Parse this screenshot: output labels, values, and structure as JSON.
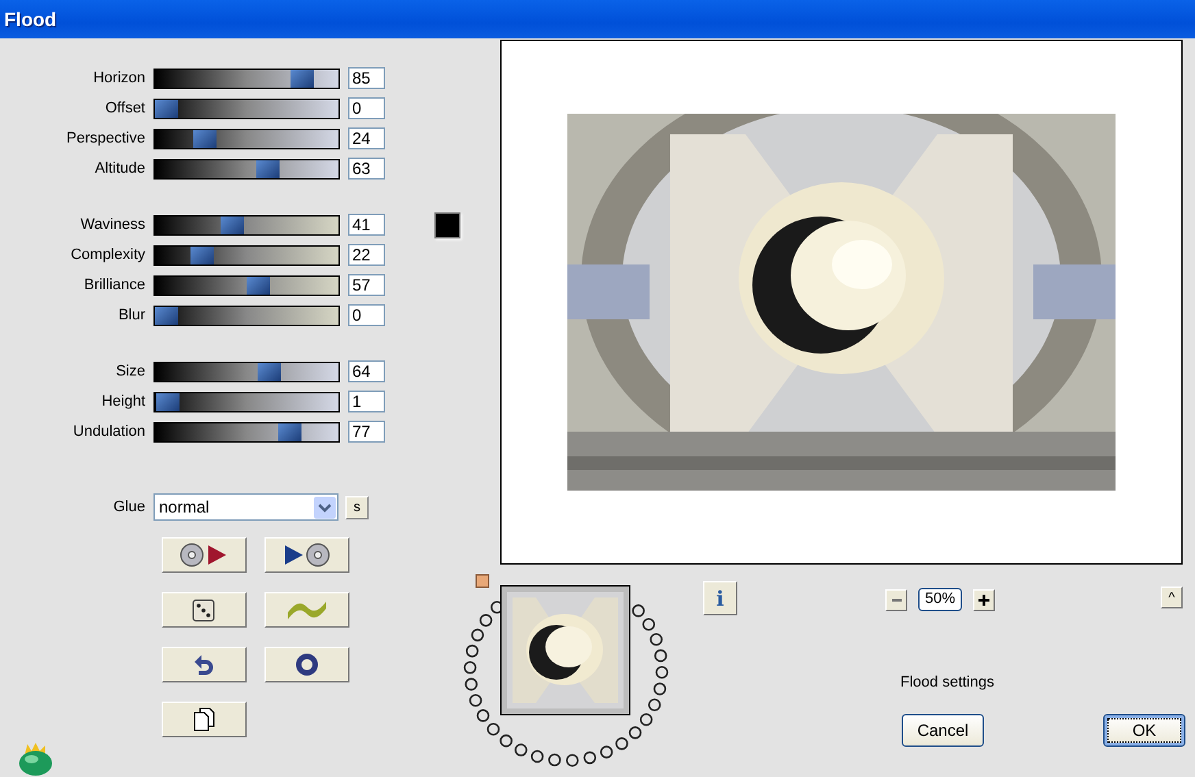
{
  "window": {
    "title": "Flood"
  },
  "slider_groups": [
    {
      "color": "#d4d8e6",
      "sliders": [
        {
          "label": "Horizon",
          "level": 0.85,
          "value": "85"
        },
        {
          "label": "Offset",
          "level": 0,
          "value": "0"
        },
        {
          "label": "Perspective",
          "level": 0.24,
          "value": "24"
        },
        {
          "label": "Altitude",
          "level": 0.63,
          "value": "63"
        }
      ]
    },
    {
      "color": "#d6d6c4",
      "swatch": {
        "color": "#000000"
      },
      "sliders": [
        {
          "label": "Waviness",
          "level": 0.41,
          "value": "41"
        },
        {
          "label": "Complexity",
          "level": 0.22,
          "value": "22"
        },
        {
          "label": "Brilliance",
          "level": 0.57,
          "value": "57"
        },
        {
          "label": "Blur",
          "level": 0,
          "value": "0"
        }
      ]
    },
    {
      "color": "#d4d8e6",
      "sliders": [
        {
          "label": "Size",
          "level": 0.64,
          "value": "64"
        },
        {
          "label": "Height",
          "level": 0.01,
          "value": "1"
        },
        {
          "label": "Undulation",
          "level": 0.77,
          "value": "77"
        }
      ]
    }
  ],
  "glue": {
    "label": "Glue",
    "value": "normal",
    "side_button": "s"
  },
  "tool_buttons": [
    {
      "kind": "load"
    },
    {
      "kind": "save"
    },
    {
      "kind": "random"
    },
    {
      "kind": "wave"
    },
    {
      "kind": "undo"
    },
    {
      "kind": "reset"
    },
    {
      "kind": "copy"
    }
  ],
  "info_button": "i",
  "zoom": {
    "value": "50%"
  },
  "collapse_button": "^",
  "status": "Flood settings",
  "buttons": [
    {
      "label": "Cancel",
      "default": false
    },
    {
      "label": "OK",
      "default": true
    }
  ]
}
